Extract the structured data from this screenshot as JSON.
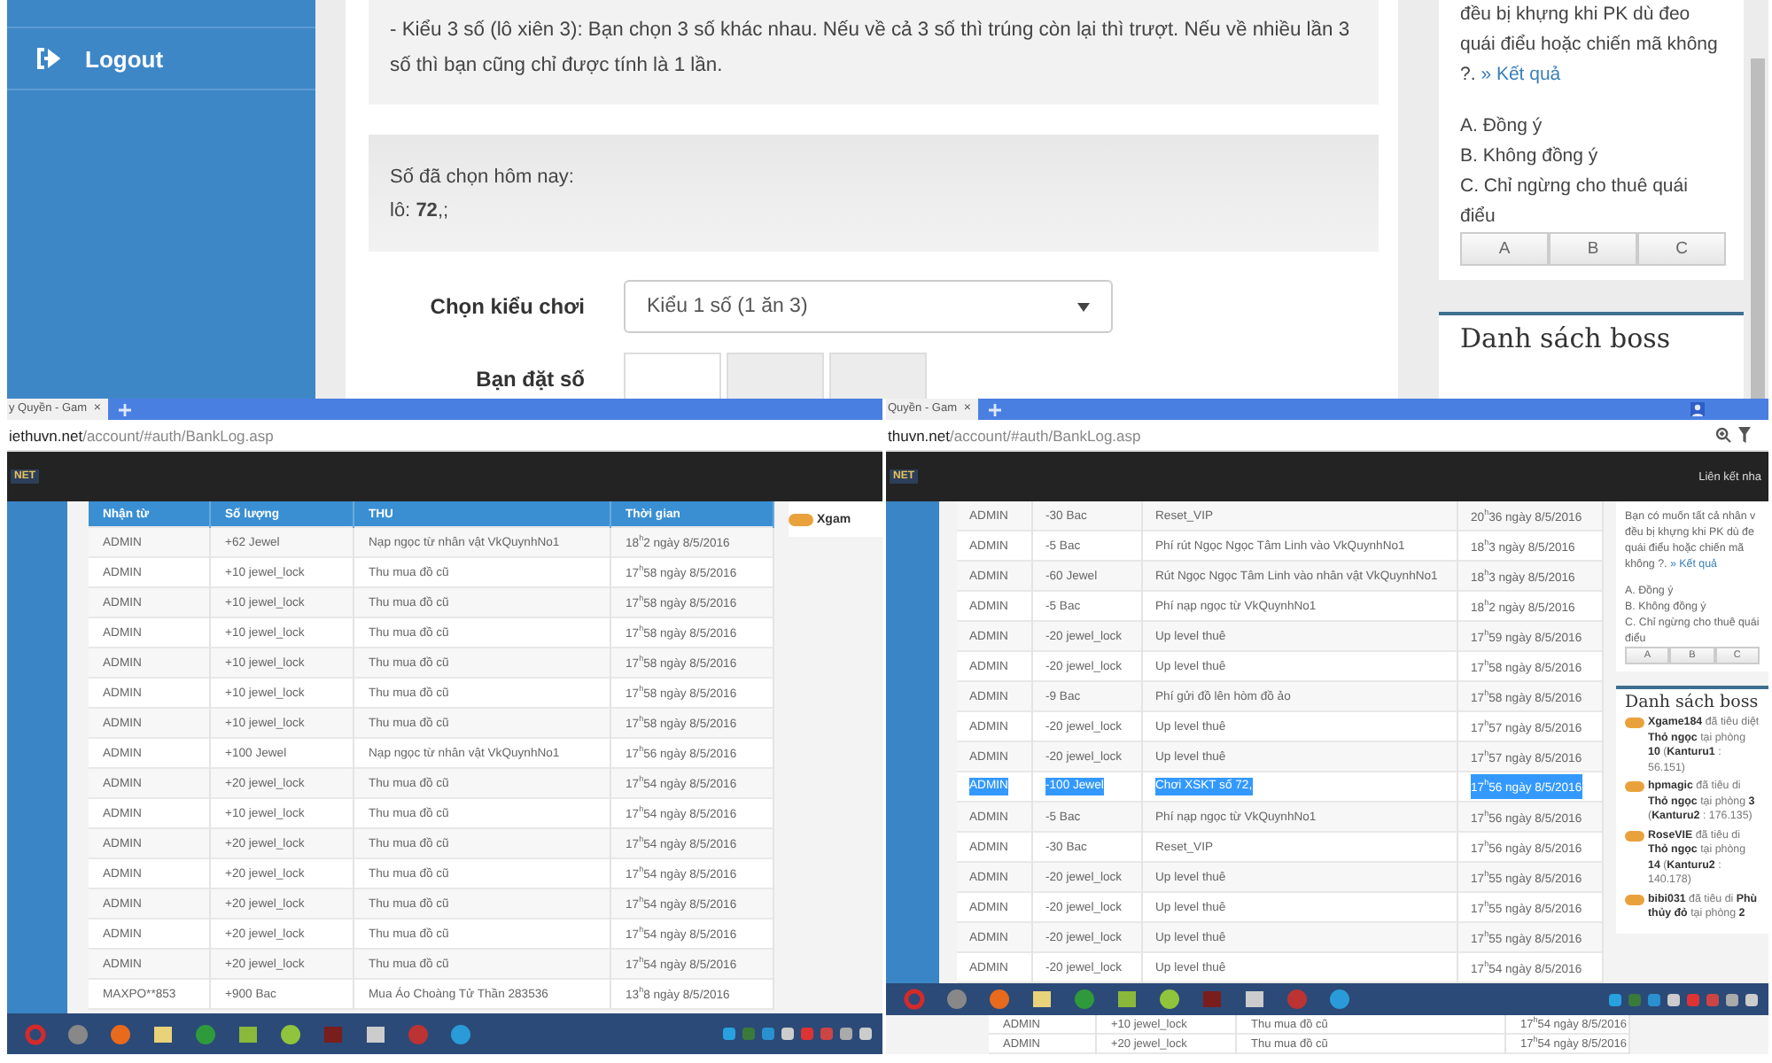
{
  "top_screen": {
    "sidebar": {
      "items": [
        {
          "label": "Logout"
        }
      ]
    },
    "rules_text": "- Kiểu 3 số (lô xiên 3): Bạn chọn 3 số khác nhau. Nếu về cả 3 số thì trúng còn lại thì trượt. Nếu về nhiều lần 3 số thì bạn cũng chỉ được tính là 1 lần.",
    "chosen_numbers": {
      "title": "Số đã chọn hôm nay:",
      "value": "lô: **72**,;"
    },
    "form": {
      "play_type_label": "Chọn kiểu chơi",
      "play_type_value": "Kiểu 1 số (1 ăn 3)",
      "number_label": "Bạn đặt số"
    },
    "poll": {
      "question": "đều bị khựng khi PK dù đeo quái điểu hoặc chiến mã không ?.",
      "result_link": "» Kết quả",
      "options": [
        "A. Đồng ý",
        "B. Không đồng ý",
        "C. Chỉ ngừng cho thuê quái điểu"
      ],
      "buttons": [
        "A",
        "B",
        "C"
      ]
    },
    "boss_panel": {
      "title": "Danh sách boss"
    }
  },
  "left_screen": {
    "tab": {
      "title": "y Quyền - Gam",
      "close": "×"
    },
    "url": {
      "domain": "iethuvn.net",
      "path": "/account/#auth/BankLog.asp"
    },
    "logo": "NET",
    "table": {
      "columns": [
        "Nhận từ",
        "Số lượng",
        "THU",
        "Thời gian"
      ],
      "rows": [
        [
          "ADMIN",
          "+62  Jewel",
          "Nạp ngọc từ nhân vật VkQuynhNo1",
          "18$^{h}$2 ngày 8/5/2016"
        ],
        [
          "ADMIN",
          "+10  jewel_lock",
          "Thu mua đồ cũ",
          "17$^{h}$58 ngày 8/5/2016"
        ],
        [
          "ADMIN",
          "+10  jewel_lock",
          "Thu mua đồ cũ",
          "17$^{h}$58 ngày 8/5/2016"
        ],
        [
          "ADMIN",
          "+10  jewel_lock",
          "Thu mua đồ cũ",
          "17$^{h}$58 ngày 8/5/2016"
        ],
        [
          "ADMIN",
          "+10  jewel_lock",
          "Thu mua đồ cũ",
          "17$^{h}$58 ngày 8/5/2016"
        ],
        [
          "ADMIN",
          "+10  jewel_lock",
          "Thu mua đồ cũ",
          "17$^{h}$58 ngày 8/5/2016"
        ],
        [
          "ADMIN",
          "+10  jewel_lock",
          "Thu mua đồ cũ",
          "17$^{h}$58 ngày 8/5/2016"
        ],
        [
          "ADMIN",
          "+100  Jewel",
          "Nạp ngọc từ nhân vật VkQuynhNo1",
          "17$^{h}$56 ngày 8/5/2016"
        ],
        [
          "ADMIN",
          "+20  jewel_lock",
          "Thu mua đồ cũ",
          "17$^{h}$54 ngày 8/5/2016"
        ],
        [
          "ADMIN",
          "+10  jewel_lock",
          "Thu mua đồ cũ",
          "17$^{h}$54 ngày 8/5/2016"
        ],
        [
          "ADMIN",
          "+20  jewel_lock",
          "Thu mua đồ cũ",
          "17$^{h}$54 ngày 8/5/2016"
        ],
        [
          "ADMIN",
          "+20  jewel_lock",
          "Thu mua đồ cũ",
          "17$^{h}$54 ngày 8/5/2016"
        ],
        [
          "ADMIN",
          "+20  jewel_lock",
          "Thu mua đồ cũ",
          "17$^{h}$54 ngày 8/5/2016"
        ],
        [
          "ADMIN",
          "+20  jewel_lock",
          "Thu mua đồ cũ",
          "17$^{h}$54 ngày 8/5/2016"
        ],
        [
          "ADMIN",
          "+20  jewel_lock",
          "Thu mua đồ cũ",
          "17$^{h}$54 ngày 8/5/2016"
        ],
        [
          "MAXPO**853",
          "+900  Bac",
          "Mua Áo Choàng Tử Thần 283536",
          "13$^{h}$8 ngày 8/5/2016"
        ]
      ]
    },
    "boss_card": {
      "text": "Xgam"
    }
  },
  "right_screen": {
    "tab": {
      "title": "Quyền - Gam",
      "close": "×"
    },
    "url": {
      "domain": "thuvn.net",
      "path": "/account/#auth/BankLog.asp"
    },
    "logo": "NET",
    "nav_link": "Liên kết nha",
    "table": {
      "rows": [
        {
          "cells": [
            "ADMIN",
            "-30  Bac",
            "Reset_VIP",
            "20$^{h}$36 ngày 8/5/2016"
          ],
          "selected": false
        },
        {
          "cells": [
            "ADMIN",
            "-5  Bac",
            "Phí rút Ngọc Ngọc Tâm Linh vào VkQuynhNo1",
            "18$^{h}$3 ngày 8/5/2016"
          ],
          "selected": false
        },
        {
          "cells": [
            "ADMIN",
            "-60  Jewel",
            "Rút Ngọc Ngọc Tâm Linh vào nhân vật VkQuynhNo1",
            "18$^{h}$3 ngày 8/5/2016"
          ],
          "selected": false
        },
        {
          "cells": [
            "ADMIN",
            "-5  Bac",
            "Phí nạp ngọc từ VkQuynhNo1",
            "18$^{h}$2 ngày 8/5/2016"
          ],
          "selected": false
        },
        {
          "cells": [
            "ADMIN",
            "-20  jewel_lock",
            "Up level thuê",
            "17$^{h}$59 ngày 8/5/2016"
          ],
          "selected": false
        },
        {
          "cells": [
            "ADMIN",
            "-20  jewel_lock",
            "Up level thuê",
            "17$^{h}$58 ngày 8/5/2016"
          ],
          "selected": false
        },
        {
          "cells": [
            "ADMIN",
            "-9  Bac",
            "Phí gửi đồ lên hòm đồ ảo",
            "17$^{h}$58 ngày 8/5/2016"
          ],
          "selected": false
        },
        {
          "cells": [
            "ADMIN",
            "-20  jewel_lock",
            "Up level thuê",
            "17$^{h}$57 ngày 8/5/2016"
          ],
          "selected": false
        },
        {
          "cells": [
            "ADMIN",
            "-20  jewel_lock",
            "Up level thuê",
            "17$^{h}$57 ngày 8/5/2016"
          ],
          "selected": false
        },
        {
          "cells": [
            "ADMIN",
            "-100  Jewel",
            "Chơi XSKT số 72,",
            "17$^{h}$56 ngày 8/5/2016"
          ],
          "selected": true
        },
        {
          "cells": [
            "ADMIN",
            "-5  Bac",
            "Phí nạp ngọc từ VkQuynhNo1",
            "17$^{h}$56 ngày 8/5/2016"
          ],
          "selected": false
        },
        {
          "cells": [
            "ADMIN",
            "-30  Bac",
            "Reset_VIP",
            "17$^{h}$56 ngày 8/5/2016"
          ],
          "selected": false
        },
        {
          "cells": [
            "ADMIN",
            "-20  jewel_lock",
            "Up level thuê",
            "17$^{h}$55 ngày 8/5/2016"
          ],
          "selected": false
        },
        {
          "cells": [
            "ADMIN",
            "-20  jewel_lock",
            "Up level thuê",
            "17$^{h}$55 ngày 8/5/2016"
          ],
          "selected": false
        },
        {
          "cells": [
            "ADMIN",
            "-20  jewel_lock",
            "Up level thuê",
            "17$^{h}$55 ngày 8/5/2016"
          ],
          "selected": false
        },
        {
          "cells": [
            "ADMIN",
            "-20  jewel_lock",
            "Up level thuê",
            "17$^{h}$54 ngày 8/5/2016"
          ],
          "selected": false
        }
      ]
    },
    "poll": {
      "question": "Bạn có muốn tất cả nhân v đều bị khựng khi PK dù đe quái điểu hoặc chiến mã không ?.",
      "result_link": "» Kết quả",
      "options": [
        "A. Đồng ý",
        "B. Không đồng ý",
        "C. Chỉ ngừng cho thuê quái điểu"
      ],
      "buttons": [
        "A",
        "B",
        "C"
      ]
    },
    "boss_panel": {
      "title": "Danh sách boss",
      "entries": [
        "**Xgame184** đã tiêu diệt **Thỏ ngọc** tại phòng **10** (**Kanturu1** : 56.151)",
        "**hpmagic** đã tiêu di **Thỏ ngọc** tại phòng **3** (**Kanturu2** : 176.135)",
        "**RoseVIE** đã tiêu di **Thỏ ngọc** tại phòng **14** (**Kanturu2** : 140.178)",
        "**bibi031** đã tiêu di **Phù thủy đỏ** tại phòng **2**"
      ]
    },
    "lower_rows": [
      [
        "ADMIN",
        "+10  jewel_lock",
        "Thu mua đồ cũ",
        "17$^{h}$54 ngày 8/5/2016"
      ],
      [
        "ADMIN",
        "+20  jewel_lock",
        "Thu mua đồ cũ",
        "17$^{h}$54 ngày 8/5/2016"
      ]
    ]
  }
}
